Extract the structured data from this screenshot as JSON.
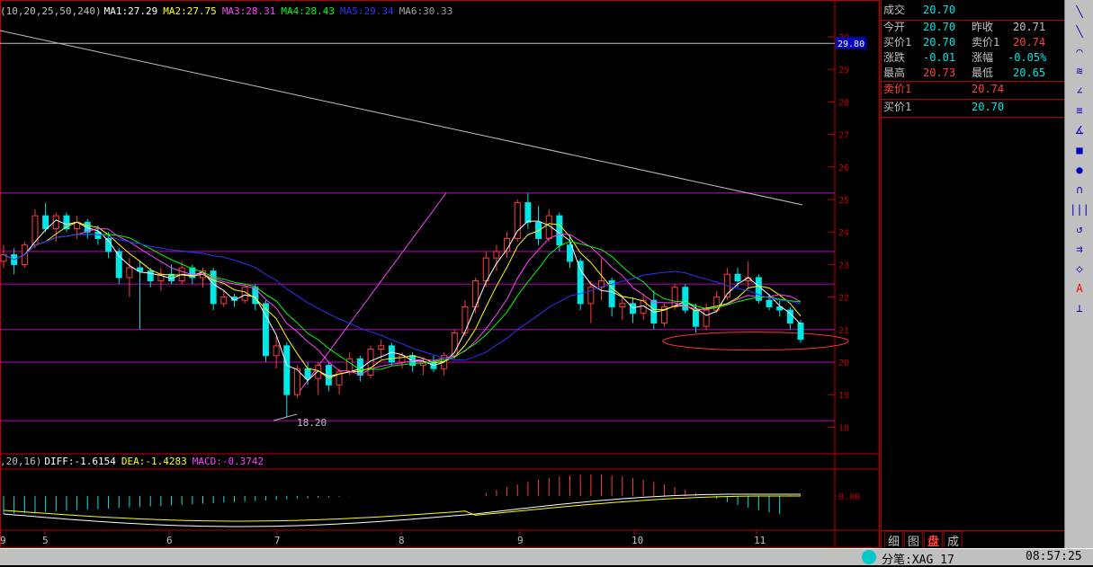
{
  "legend_ma": {
    "params": "(10,20,25,50,240)",
    "ma1": "MA1:27.29",
    "ma2": "MA2:27.75",
    "ma3": "MA3:28.31",
    "ma4": "MA4:28.43",
    "ma5": "MA5:29.34",
    "ma6": "MA6:30.33"
  },
  "legend_macd": {
    "params": ",20,16)",
    "diff": "DIFF:-1.6154",
    "dea": "DEA:-1.4283",
    "macd": "MACD:-0.3742"
  },
  "colors": {
    "up": "#ff3b3b",
    "down": "#00e5e5",
    "ma1": "#ffffff",
    "ma2": "#ffff00",
    "ma3": "#ff40ff",
    "ma4": "#00ff00",
    "ma5": "#3030ff",
    "ma6": "#c0c0c0",
    "grid": "#c000c0",
    "frame": "#c00000"
  },
  "chart_data": {
    "type": "candlestick",
    "y_ticks": [
      "30",
      "29",
      "28",
      "27",
      "26",
      "25",
      "24",
      "23",
      "22",
      "21",
      "20",
      "19",
      "18"
    ],
    "ylim": [
      17.8,
      30.4
    ],
    "price_tag": "29.80",
    "low_label": "18.20",
    "x_ticks": [
      "9",
      "5",
      "6",
      "7",
      "8",
      "9",
      "10",
      "11"
    ],
    "macd_zero_label": "0.00",
    "candles": [
      [
        23.1,
        23.6,
        22.9,
        23.3
      ],
      [
        23.3,
        23.5,
        22.7,
        23.0
      ],
      [
        23.0,
        23.7,
        22.9,
        23.6
      ],
      [
        23.6,
        24.7,
        23.5,
        24.5
      ],
      [
        24.5,
        24.9,
        24.0,
        24.1
      ],
      [
        24.1,
        24.6,
        23.7,
        24.5
      ],
      [
        24.5,
        24.6,
        24.0,
        24.1
      ],
      [
        24.1,
        24.5,
        23.8,
        24.3
      ],
      [
        24.3,
        24.4,
        23.8,
        24.0
      ],
      [
        24.0,
        24.2,
        23.6,
        23.8
      ],
      [
        23.8,
        24.0,
        23.2,
        23.4
      ],
      [
        23.4,
        23.5,
        22.4,
        22.6
      ],
      [
        22.6,
        23.2,
        22.0,
        22.9
      ],
      [
        22.9,
        23.1,
        21.0,
        22.8
      ],
      [
        22.8,
        22.9,
        22.3,
        22.5
      ],
      [
        22.5,
        22.9,
        22.2,
        22.7
      ],
      [
        22.7,
        23.0,
        22.4,
        22.5
      ],
      [
        22.5,
        23.1,
        22.4,
        22.9
      ],
      [
        22.9,
        23.0,
        22.4,
        22.6
      ],
      [
        22.6,
        22.9,
        22.3,
        22.8
      ],
      [
        22.8,
        22.9,
        21.6,
        21.8
      ],
      [
        21.8,
        22.2,
        21.7,
        22.0
      ],
      [
        22.0,
        22.1,
        21.7,
        21.9
      ],
      [
        21.9,
        22.4,
        21.8,
        22.3
      ],
      [
        22.3,
        22.4,
        21.6,
        21.8
      ],
      [
        21.8,
        21.9,
        20.0,
        20.2
      ],
      [
        20.2,
        20.8,
        19.8,
        20.5
      ],
      [
        20.5,
        20.6,
        18.3,
        19.0
      ],
      [
        19.0,
        19.9,
        18.9,
        19.8
      ],
      [
        19.8,
        20.0,
        19.3,
        19.5
      ],
      [
        19.5,
        20.0,
        19.0,
        19.9
      ],
      [
        19.9,
        20.0,
        19.1,
        19.3
      ],
      [
        19.3,
        19.8,
        19.0,
        19.7
      ],
      [
        19.7,
        20.3,
        19.6,
        20.1
      ],
      [
        20.1,
        20.2,
        19.4,
        19.6
      ],
      [
        19.6,
        20.5,
        19.5,
        20.4
      ],
      [
        20.4,
        20.7,
        20.1,
        20.5
      ],
      [
        20.5,
        20.6,
        19.9,
        20.0
      ],
      [
        20.0,
        20.3,
        19.8,
        20.2
      ],
      [
        20.2,
        20.3,
        19.7,
        19.9
      ],
      [
        19.9,
        20.1,
        19.6,
        20.0
      ],
      [
        20.0,
        20.2,
        19.7,
        19.8
      ],
      [
        19.8,
        20.3,
        19.6,
        20.2
      ],
      [
        20.2,
        21.0,
        20.1,
        20.9
      ],
      [
        20.9,
        21.9,
        20.8,
        21.7
      ],
      [
        21.7,
        22.6,
        21.5,
        22.5
      ],
      [
        22.5,
        23.4,
        22.3,
        23.2
      ],
      [
        23.2,
        23.6,
        22.8,
        23.4
      ],
      [
        23.4,
        24.0,
        23.2,
        23.8
      ],
      [
        23.8,
        25.0,
        23.7,
        24.9
      ],
      [
        24.9,
        25.2,
        24.1,
        24.3
      ],
      [
        24.3,
        24.8,
        23.6,
        23.8
      ],
      [
        23.8,
        24.7,
        23.7,
        24.5
      ],
      [
        24.5,
        24.6,
        23.4,
        23.6
      ],
      [
        23.6,
        23.9,
        22.9,
        23.1
      ],
      [
        23.1,
        23.2,
        21.6,
        21.8
      ],
      [
        21.8,
        22.5,
        21.2,
        22.3
      ],
      [
        22.3,
        23.2,
        21.9,
        22.5
      ],
      [
        22.5,
        22.6,
        21.4,
        21.7
      ],
      [
        21.7,
        22.0,
        21.3,
        21.8
      ],
      [
        21.8,
        22.0,
        21.2,
        21.5
      ],
      [
        21.5,
        22.1,
        21.3,
        21.9
      ],
      [
        21.9,
        22.2,
        21.0,
        21.2
      ],
      [
        21.2,
        21.8,
        21.1,
        21.7
      ],
      [
        21.7,
        22.4,
        21.6,
        22.3
      ],
      [
        22.3,
        22.4,
        21.5,
        21.6
      ],
      [
        21.6,
        21.8,
        20.9,
        21.1
      ],
      [
        21.1,
        21.8,
        21.0,
        21.6
      ],
      [
        21.6,
        22.2,
        21.5,
        22.0
      ],
      [
        22.0,
        22.9,
        21.9,
        22.7
      ],
      [
        22.7,
        22.9,
        22.3,
        22.5
      ],
      [
        22.5,
        23.1,
        22.3,
        22.6
      ],
      [
        22.6,
        22.7,
        21.8,
        21.9
      ],
      [
        21.9,
        22.1,
        21.6,
        21.7
      ],
      [
        21.7,
        21.9,
        21.4,
        21.6
      ],
      [
        21.6,
        21.7,
        21.0,
        21.2
      ],
      [
        21.2,
        21.3,
        20.6,
        20.7
      ]
    ]
  },
  "panel": {
    "r1": {
      "l": "成交",
      "v": "20.70"
    },
    "r2": {
      "l1": "今开",
      "v1": "20.70",
      "l2": "昨收",
      "v2": "20.71"
    },
    "r3": {
      "l1": "买价1",
      "v1": "20.70",
      "l2": "卖价1",
      "v2": "20.74"
    },
    "r4": {
      "l1": "涨跌",
      "v1": "-0.01",
      "l2": "涨幅",
      "v2": "-0.05%"
    },
    "r5": {
      "l1": "最高",
      "v1": "20.73",
      "l2": "最低",
      "v2": "20.65"
    },
    "r6": {
      "l": "卖价1",
      "v": "20.74"
    },
    "r7": {
      "l": "买价1",
      "v": "20.70"
    }
  },
  "tabs": [
    "细",
    "图",
    "盘",
    "成"
  ],
  "toolbar": [
    "╲",
    "╲",
    "⌒",
    "≋",
    "∠",
    "≡",
    "∡",
    "■",
    "●",
    "∩",
    "|||",
    "↺",
    "⇉",
    "◇",
    "A",
    "⊥"
  ],
  "status": {
    "left": "分笔:XAG 17",
    "time": "08:57:25"
  }
}
